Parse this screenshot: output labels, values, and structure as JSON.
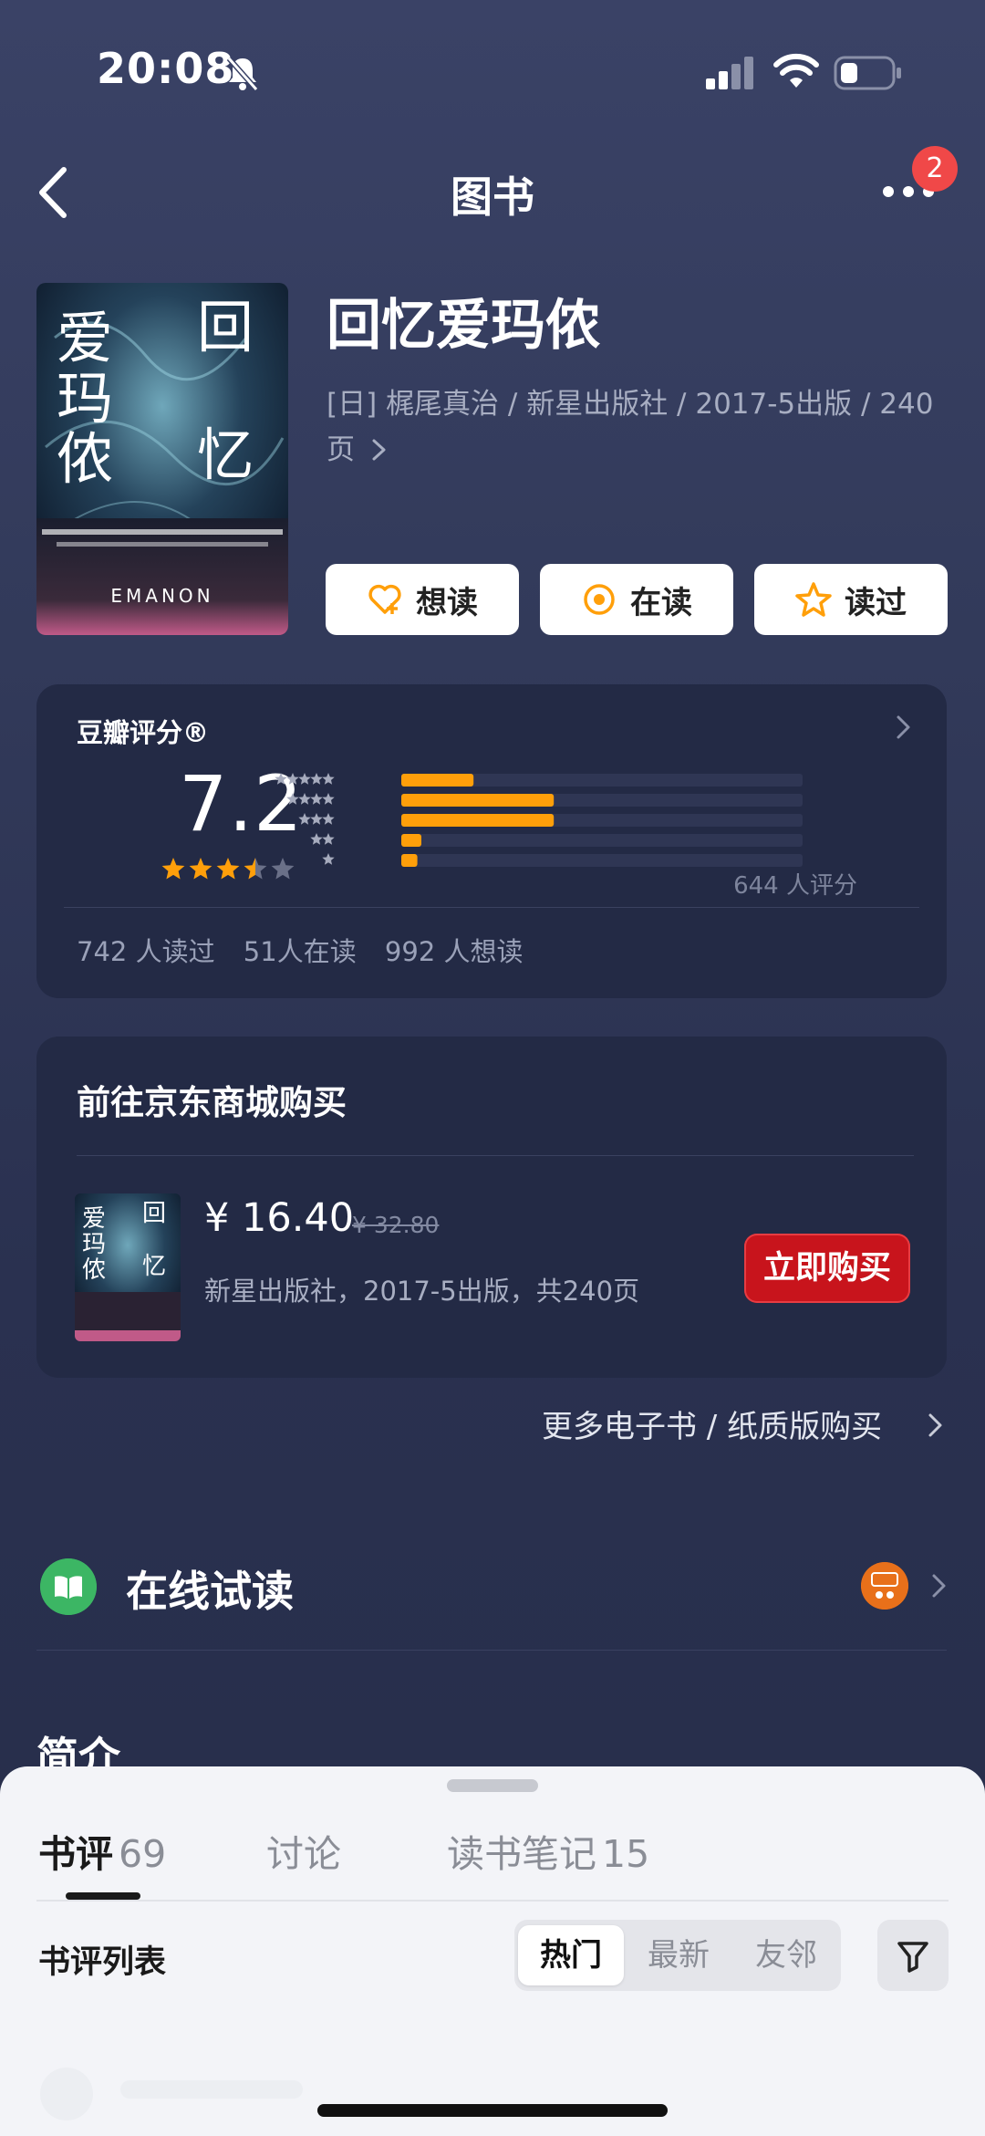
{
  "status_bar": {
    "time": "20:08"
  },
  "nav": {
    "title": "图书",
    "badge_count": "2"
  },
  "book": {
    "title": "回忆爱玛侬",
    "meta": "[日] 梶尾真治 / 新星出版社 / 2017-5出版 / 240页",
    "cover_title": "回忆爱玛侬",
    "cover_brand": "EMANON"
  },
  "actions": [
    {
      "label": "想读",
      "icon": "heart-plus-icon"
    },
    {
      "label": "在读",
      "icon": "reading-circle-icon"
    },
    {
      "label": "读过",
      "icon": "star-outline-icon"
    }
  ],
  "rating": {
    "label": "豆瓣评分®",
    "score": "7.2",
    "stars": 3.5,
    "distribution": [
      0.18,
      0.38,
      0.38,
      0.05,
      0.04
    ],
    "count_text": "644 人评分",
    "stats": [
      "742 人读过",
      "51人在读",
      "992 人想读"
    ],
    "colors": {
      "bar": "#ff9f0a",
      "track": "#2f3654",
      "star": "#ff9f0a"
    }
  },
  "purchase": {
    "title": "前往京东商城购买",
    "price": "¥ 16.40",
    "original_price": "¥ 32.80",
    "description": "新星出版社，2017-5出版，共240页",
    "button": "立即购买",
    "more_link": "更多电子书 / 纸质版购买"
  },
  "online_read": {
    "label": "在线试读"
  },
  "intro": {
    "heading": "简介"
  },
  "sheet": {
    "tabs": [
      {
        "label": "书评",
        "count": "69",
        "active": true
      },
      {
        "label": "讨论",
        "count": "",
        "active": false
      },
      {
        "label": "读书笔记",
        "count": "15",
        "active": false
      }
    ],
    "list_label": "书评列表",
    "sort_options": [
      "热门",
      "最新",
      "友邻"
    ],
    "selected_sort": "热门"
  }
}
